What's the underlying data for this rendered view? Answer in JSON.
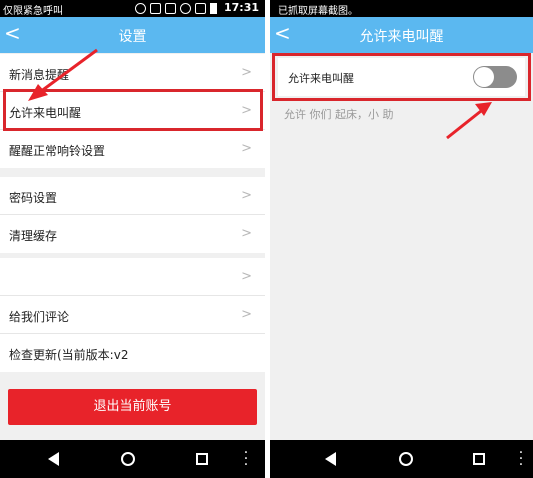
{
  "left": {
    "status": {
      "text": "仅限紧急呼叫",
      "time": "17:31"
    },
    "title": "设置",
    "group1": [
      "新消息提醒",
      "允许来电叫醒",
      "醒醒正常响铃设置"
    ],
    "group2": [
      "密码设置",
      "清理缓存"
    ],
    "group3": [
      "",
      "给我们评论",
      "检查更新(当前版本:v2"
    ],
    "logout_label": "退出当前账号"
  },
  "right": {
    "status": {
      "text": "已抓取屏幕截图。"
    },
    "title": "允许来电叫醒",
    "toggle_label": "允许来电叫醒",
    "toggle_on": false,
    "description": "允许 你们 起床，小 助"
  },
  "colors": {
    "appbar": "#5bb8f0",
    "logout": "#e8232a",
    "highlight": "#d9262c",
    "toggle_off": "#8c8c8c"
  },
  "icons": [
    "back-arrow-icon",
    "chevron-right-icon",
    "nav-back-icon",
    "nav-home-icon",
    "nav-recent-icon",
    "nav-menu-icon"
  ]
}
